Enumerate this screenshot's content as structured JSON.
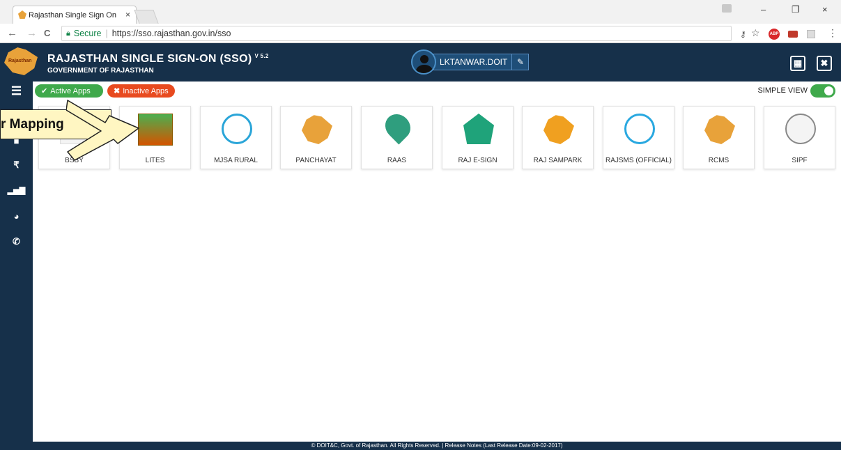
{
  "browser": {
    "tab_title": "Rajasthan Single Sign On",
    "tab_close": "×",
    "window_buttons": {
      "minimize": "–",
      "restore": "❐",
      "close": "×"
    },
    "nav": {
      "back": "←",
      "forward": "→",
      "reload": "C"
    },
    "address": {
      "secure_label": "Secure",
      "separator": "|",
      "url": "https://sso.rajasthan.gov.in/sso"
    },
    "extensions": {
      "abp": "ABP"
    }
  },
  "header": {
    "title": "RAJASTHAN SINGLE SIGN-ON (SSO)",
    "version": "V 5.2",
    "subtitle": "GOVERNMENT OF RAJASTHAN",
    "username": "LKTANWAR.DOIT",
    "logo_text": "Rajasthan"
  },
  "filters": {
    "active_label": "Active Apps",
    "inactive_label": "Inactive Apps",
    "simple_view_label": "SIMPLE VIEW"
  },
  "callout": {
    "text": "r Mapping"
  },
  "apps": [
    {
      "label": "BSBY",
      "icon": "bsby-icon"
    },
    {
      "label": "LITES",
      "icon": "lites-icon"
    },
    {
      "label": "MJSA RURAL",
      "icon": "mjsa-icon"
    },
    {
      "label": "PANCHAYAT",
      "icon": "panchayat-icon"
    },
    {
      "label": "RAAS",
      "icon": "raas-icon"
    },
    {
      "label": "RAJ E-SIGN",
      "icon": "esign-icon"
    },
    {
      "label": "RAJ SAMPARK",
      "icon": "sampark-icon"
    },
    {
      "label": "RAJSMS (OFFICIAL)",
      "icon": "rajsms-icon"
    },
    {
      "label": "RCMS",
      "icon": "rcms-icon"
    },
    {
      "label": "SIPF",
      "icon": "sipf-icon"
    }
  ],
  "sidebar_icons": [
    "menu-icon",
    "briefcase-icon",
    "rupee-icon",
    "bar-chart-icon",
    "pie-chart-icon",
    "phone-icon"
  ],
  "footer": {
    "text": "© DOIT&C, Govt. of Rajasthan. All Rights Reserved.  |  Release Notes (Last Release Date:09-02-2017)"
  },
  "colors": {
    "header_bg": "#16304a",
    "active": "#3fa94b",
    "inactive": "#e84a1f",
    "accent": "#e8a23a"
  }
}
